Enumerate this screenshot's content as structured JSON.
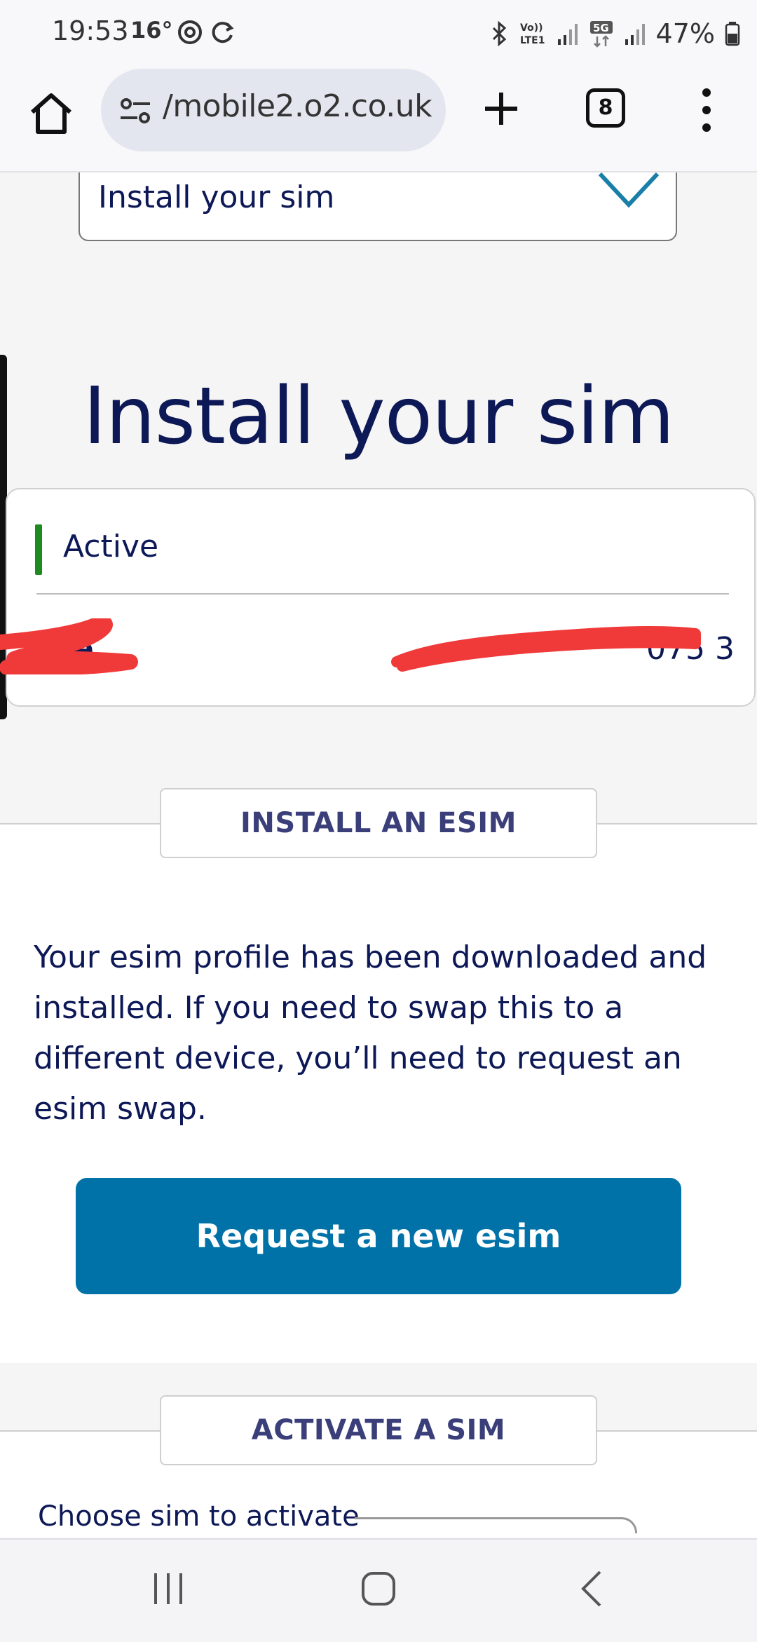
{
  "status_bar": {
    "time": "19:53",
    "temperature": "16°",
    "battery": "47%",
    "icons": [
      "threads-icon",
      "sync-icon",
      "bluetooth-icon",
      "volte-icon",
      "signal-icon",
      "5g-icon",
      "signal-icon",
      "battery-icon"
    ]
  },
  "browser": {
    "url": "/mobile2.o2.co.uk",
    "tab_count": "8",
    "icons": [
      "home-icon",
      "tune-icon",
      "plus-icon",
      "tabs-icon",
      "more-vert-icon"
    ]
  },
  "page": {
    "dropdown_value": "Install your sim",
    "title": "Install your sim",
    "sim_card": {
      "status": "Active",
      "row_label": "D  e",
      "row_value": "075        3"
    },
    "install_esim": {
      "tab_label": "INSTALL AN ESIM",
      "description": "Your esim profile has been downloaded and installed. If you need to swap this to a different device, you’ll need to request an esim swap.",
      "button_label": "Request a new esim"
    },
    "activate_sim": {
      "tab_label": "ACTIVATE A SIM",
      "choose_label": "Choose sim to activate"
    }
  },
  "nav_bar": {
    "icons": [
      "recents-icon",
      "home-circle-icon",
      "back-icon"
    ]
  },
  "colors": {
    "brand_navy": "#0d1856",
    "button_blue": "#0072a8",
    "active_green": "#1f8a1f",
    "redaction_red": "#f03a3a"
  }
}
